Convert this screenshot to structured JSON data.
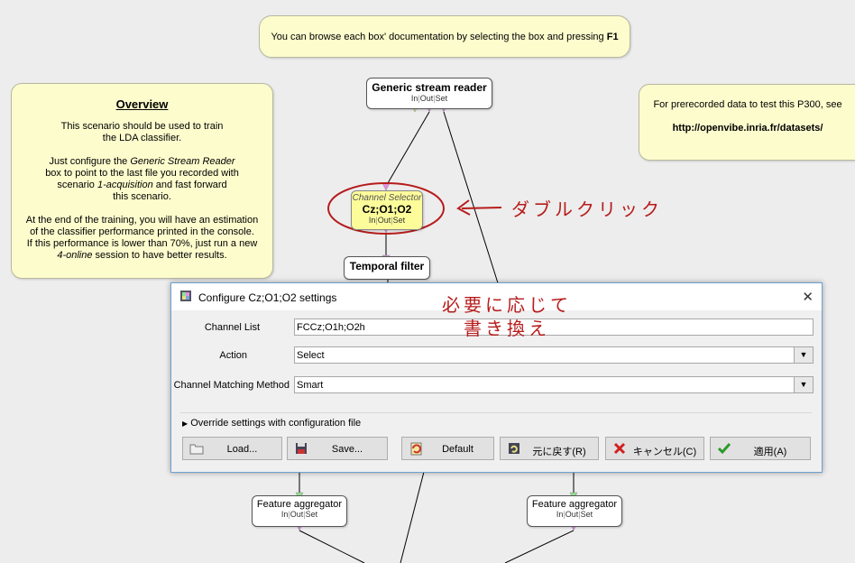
{
  "notes": {
    "top_hint": {
      "text": "You can browse each box' documentation by selecting the box and pressing ",
      "key": "F1"
    },
    "overview": {
      "title": "Overview",
      "p1_l1": "This scenario should be used to train",
      "p1_l2": "the LDA classifier.",
      "p2_l1a": "Just configure the ",
      "p2_l1b": "Generic Stream Reader",
      "p2_l2": "box to point to the last file you recorded with",
      "p2_l3a": "scenario ",
      "p2_l3b": "1-acquisition",
      "p2_l3c": " and fast forward",
      "p2_l4": "this scenario.",
      "p3_l1": "At the end of the training, you will have an estimation",
      "p3_l2": "of the classifier performance printed in the console.",
      "p3_l3": "If this performance is lower than 70%, just run a new",
      "p3_l4a": "4-online",
      "p3_l4b": " session to have better results."
    },
    "datasets": {
      "line1": "For prerecorded data to test this P300, see",
      "url": "http://openvibe.inria.fr/datasets/"
    }
  },
  "boxes": {
    "reader": {
      "title": "Generic stream reader"
    },
    "channel_selector": {
      "subtitle": "Channel Selector",
      "title": "Cz;O1;O2"
    },
    "temporal": {
      "title": "Temporal filter"
    },
    "agg_left": {
      "title": "Feature aggregator"
    },
    "agg_right": {
      "title": "Feature aggregator"
    },
    "ports": {
      "in": "In",
      "sep": "|",
      "out": "Out",
      "set": "Set"
    }
  },
  "annotations": {
    "double_click": "ダブルクリック",
    "rewrite_line1": "必要に応じて",
    "rewrite_line2": "書き換え"
  },
  "dialog": {
    "title": "Configure Cz;O1;O2 settings",
    "close_glyph": "✕",
    "fields": {
      "channel_list_label": "Channel List",
      "channel_list_value": "FCCz;O1h;O2h",
      "action_label": "Action",
      "action_value": "Select",
      "matching_label": "Channel Matching Method",
      "matching_value": "Smart"
    },
    "override_label": "Override settings with configuration file",
    "buttons": {
      "load": "Load...",
      "save": "Save...",
      "default": "Default",
      "revert": "元に戻す(R)",
      "cancel": "キャンセル(C)",
      "apply": "適用(A)"
    }
  },
  "colors": {
    "note_bg": "#fdfccd",
    "selected_box_bg": "#fdfc9a",
    "annotation_red": "#b71c1c",
    "port_pink": "#e58ee5",
    "port_yellow": "#e8e080",
    "port_green": "#8fe28f"
  }
}
